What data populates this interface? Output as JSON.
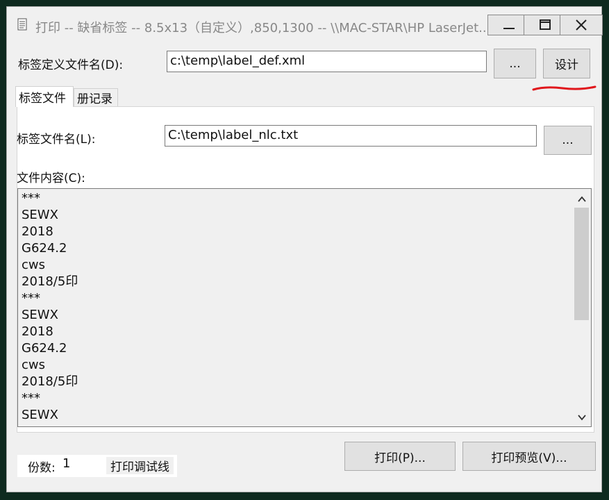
{
  "window": {
    "title": "打印 -- 缺省标签 -- 8.5x13（自定义）,850,1300 -- \\\\MAC-STAR\\HP LaserJet..."
  },
  "label_def": {
    "label": "标签定义文件名(D):",
    "value": "c:\\temp\\label_def.xml",
    "browse_label": "...",
    "design_label": "设计"
  },
  "tabs": [
    {
      "label": "标签文件"
    },
    {
      "label": "册记录"
    }
  ],
  "label_file": {
    "label": "标签文件名(L):",
    "value": "C:\\temp\\label_nlc.txt",
    "browse_label": "..."
  },
  "content": {
    "label": "文件内容(C):",
    "lines": [
      "***",
      "SEWX",
      "2018",
      "G624.2",
      "cws",
      "2018/5印",
      "***",
      "SEWX",
      "2018",
      "G624.2",
      "cws",
      "2018/5印",
      "***",
      "SEWX"
    ]
  },
  "footer": {
    "copies_label": "份数:",
    "copies_value": "1",
    "debug_label": "打印调试线",
    "print_label": "打印(P)...",
    "preview_label": "打印预览(V)..."
  },
  "colors": {
    "annotation": "#e0161b",
    "window_bg": "#f0f0f0"
  }
}
